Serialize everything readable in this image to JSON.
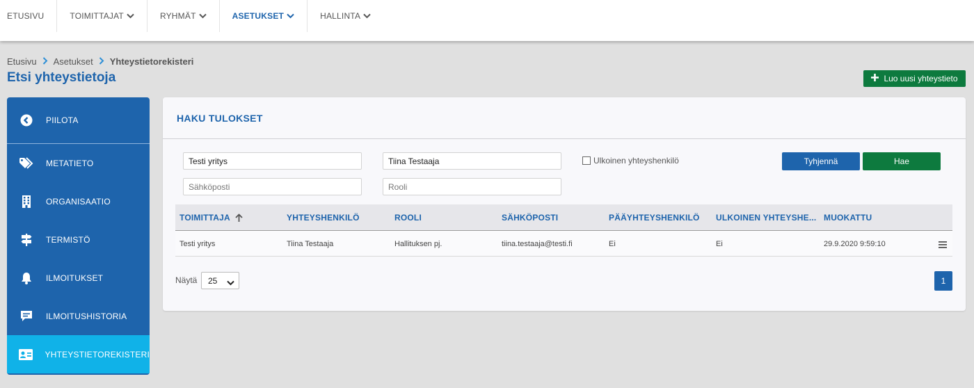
{
  "nav": {
    "items": [
      {
        "label": "ETUSIVU",
        "dropdown": false,
        "active": false
      },
      {
        "label": "TOIMITTAJAT",
        "dropdown": true,
        "active": false
      },
      {
        "label": "RYHMÄT",
        "dropdown": true,
        "active": false
      },
      {
        "label": "ASETUKSET",
        "dropdown": true,
        "active": true
      },
      {
        "label": "HALLINTA",
        "dropdown": true,
        "active": false
      }
    ]
  },
  "breadcrumb": [
    "Etusivu",
    "Asetukset",
    "Yhteystietorekisteri"
  ],
  "page_title": "Etsi yhteystietoja",
  "create_button": {
    "label": "Luo uusi yhteystieto",
    "icon": "plus-icon"
  },
  "sidebar": {
    "items": [
      {
        "label": "PIILOTA",
        "icon": "chevron-left-circle-icon"
      },
      {
        "label": "METATIETO",
        "icon": "tags-icon"
      },
      {
        "label": "ORGANISAATIO",
        "icon": "building-icon"
      },
      {
        "label": "TERMISTÖ",
        "icon": "signpost-icon"
      },
      {
        "label": "ILMOITUKSET",
        "icon": "bell-icon"
      },
      {
        "label": "ILMOITUSHISTORIA",
        "icon": "message-icon"
      },
      {
        "label": "YHTEYSTIETOREKISTERI",
        "icon": "contact-card-icon",
        "active": true
      }
    ]
  },
  "panel": {
    "title": "HAKU TULOKSET",
    "filters": {
      "supplier": {
        "value": "Testi yritys",
        "placeholder": ""
      },
      "contact": {
        "value": "Tiina Testaaja",
        "placeholder": ""
      },
      "email": {
        "value": "",
        "placeholder": "Sähköposti"
      },
      "role": {
        "value": "",
        "placeholder": "Rooli"
      },
      "external_label": "Ulkoinen yhteyshenkilö",
      "external_checked": false
    },
    "clear_label": "Tyhjennä",
    "search_label": "Hae"
  },
  "table": {
    "columns": [
      "TOIMITTAJA",
      "YHTEYSHENKILÖ",
      "ROOLI",
      "SÄHKÖPOSTI",
      "PÄÄYHTEYSHENKILÖ",
      "ULKOINEN YHTEYSHE...",
      "MUOKATTU"
    ],
    "sort_column": "TOIMITTAJA",
    "sort_direction": "ascending",
    "rows": [
      [
        "Testi yritys",
        "Tiina Testaaja",
        "Hallituksen pj.",
        "tiina.testaaja@testi.fi",
        "Ei",
        "Ei",
        "29.9.2020 9:59:10"
      ]
    ]
  },
  "pagination": {
    "show_label": "Näytä",
    "page_size": "25",
    "current_page": "1"
  },
  "colors": {
    "primary_blue": "#1e64ac",
    "active_cyan": "#10b2e8",
    "green": "#0d7a3e",
    "background": "#e0e0e0"
  }
}
